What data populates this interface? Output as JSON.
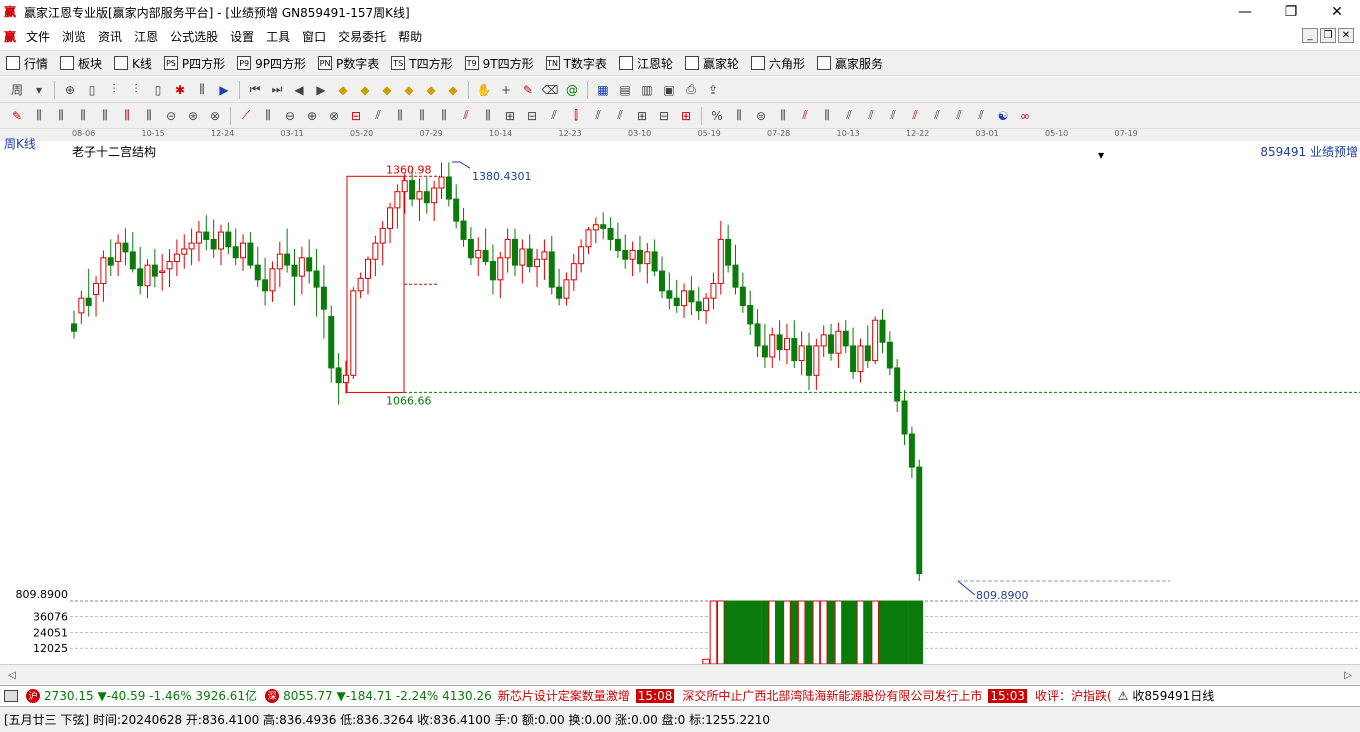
{
  "window": {
    "title": "赢家江恩专业版[赢家内部服务平台] - [业绩预增  GN859491-157周K线]",
    "logo_char": "赢",
    "min": "—",
    "max": "❐",
    "close": "✕"
  },
  "menu": {
    "items": [
      "文件",
      "浏览",
      "资讯",
      "江恩",
      "公式选股",
      "设置",
      "工具",
      "窗口",
      "交易委托",
      "帮助"
    ]
  },
  "toolbar1": {
    "items": [
      {
        "icon": "grid-icon",
        "label": "行情"
      },
      {
        "icon": "blocks-icon",
        "label": "板块"
      },
      {
        "icon": "kline-icon",
        "label": "K线"
      },
      {
        "icon": "ps-icon",
        "label": "P四方形",
        "code": "PS"
      },
      {
        "icon": "p9-icon",
        "label": "9P四方形",
        "code": "P9"
      },
      {
        "icon": "pn-icon",
        "label": "P数字表",
        "code": "PN"
      },
      {
        "icon": "ts-icon",
        "label": "T四方形",
        "code": "TS"
      },
      {
        "icon": "t9-icon",
        "label": "9T四方形",
        "code": "T9"
      },
      {
        "icon": "tn-icon",
        "label": "T数字表",
        "code": "TN"
      },
      {
        "icon": "wheel-icon",
        "label": "江恩轮"
      },
      {
        "icon": "wheel2-icon",
        "label": "赢家轮"
      },
      {
        "icon": "hexagon-icon",
        "label": "六角形"
      },
      {
        "icon": "dollar-icon",
        "label": "赢家服务"
      }
    ]
  },
  "chart": {
    "period_label": "周K线",
    "study_name": "老子十二宫结构",
    "code_label": "859491  业绩预增",
    "date_ticks": [
      "08-06",
      "10-15",
      "12-24",
      "03-11",
      "05-20",
      "07-29",
      "10-14",
      "12-23",
      "03-10",
      "05-19",
      "07-28",
      "10-13",
      "12-22",
      "03-01",
      "05-10",
      "07-19"
    ],
    "annotations": {
      "box_top": "1360.98",
      "box_bottom": "1066.66",
      "high_label": "1380.4301",
      "low_label": "809.8900"
    },
    "volume_axis": {
      "price_left": "809.8900",
      "ticks": [
        "36076",
        "24051",
        "12025"
      ]
    },
    "colors": {
      "up": "#e00000",
      "down": "#0a7a0a",
      "dash": "#0a7a0a",
      "box": "#e00000",
      "label_blue": "#1a3fa8"
    }
  },
  "chart_data": {
    "type": "candlestick",
    "title": "老子十二宫结构",
    "series": [
      {
        "name": "859491 业绩预增",
        "ohlc": [
          [
            1160,
            1178,
            1140,
            1150
          ],
          [
            1175,
            1205,
            1160,
            1195
          ],
          [
            1195,
            1235,
            1170,
            1185
          ],
          [
            1200,
            1225,
            1170,
            1215
          ],
          [
            1215,
            1260,
            1190,
            1250
          ],
          [
            1250,
            1275,
            1225,
            1240
          ],
          [
            1245,
            1282,
            1225,
            1270
          ],
          [
            1270,
            1290,
            1240,
            1258
          ],
          [
            1258,
            1285,
            1230,
            1235
          ],
          [
            1235,
            1265,
            1200,
            1212
          ],
          [
            1212,
            1248,
            1195,
            1240
          ],
          [
            1240,
            1262,
            1210,
            1225
          ],
          [
            1230,
            1255,
            1205,
            1232
          ],
          [
            1235,
            1262,
            1210,
            1245
          ],
          [
            1245,
            1275,
            1225,
            1255
          ],
          [
            1255,
            1282,
            1235,
            1262
          ],
          [
            1262,
            1290,
            1240,
            1270
          ],
          [
            1270,
            1300,
            1245,
            1285
          ],
          [
            1285,
            1308,
            1260,
            1275
          ],
          [
            1275,
            1302,
            1250,
            1262
          ],
          [
            1262,
            1295,
            1240,
            1285
          ],
          [
            1285,
            1298,
            1255,
            1265
          ],
          [
            1265,
            1290,
            1240,
            1250
          ],
          [
            1250,
            1282,
            1232,
            1270
          ],
          [
            1270,
            1285,
            1235,
            1240
          ],
          [
            1240,
            1265,
            1210,
            1220
          ],
          [
            1220,
            1250,
            1185,
            1205
          ],
          [
            1205,
            1245,
            1190,
            1235
          ],
          [
            1235,
            1272,
            1210,
            1255
          ],
          [
            1255,
            1290,
            1230,
            1240
          ],
          [
            1240,
            1262,
            1185,
            1225
          ],
          [
            1225,
            1265,
            1200,
            1250
          ],
          [
            1250,
            1275,
            1215,
            1232
          ],
          [
            1232,
            1262,
            1170,
            1210
          ],
          [
            1210,
            1240,
            1140,
            1180
          ],
          [
            1170,
            1185,
            1080,
            1100
          ],
          [
            1100,
            1120,
            1050,
            1080
          ],
          [
            1080,
            1110,
            1065,
            1090
          ],
          [
            1090,
            1210,
            1085,
            1205
          ],
          [
            1205,
            1230,
            1195,
            1222
          ],
          [
            1222,
            1252,
            1200,
            1248
          ],
          [
            1248,
            1280,
            1225,
            1270
          ],
          [
            1270,
            1300,
            1240,
            1290
          ],
          [
            1290,
            1325,
            1270,
            1318
          ],
          [
            1318,
            1350,
            1290,
            1340
          ],
          [
            1340,
            1365,
            1310,
            1355
          ],
          [
            1355,
            1370,
            1320,
            1330
          ],
          [
            1330,
            1358,
            1300,
            1340
          ],
          [
            1340,
            1360,
            1310,
            1325
          ],
          [
            1325,
            1355,
            1300,
            1345
          ],
          [
            1345,
            1380,
            1330,
            1360
          ],
          [
            1360,
            1380,
            1320,
            1330
          ],
          [
            1330,
            1350,
            1290,
            1300
          ],
          [
            1300,
            1318,
            1265,
            1275
          ],
          [
            1275,
            1292,
            1240,
            1250
          ],
          [
            1250,
            1278,
            1225,
            1260
          ],
          [
            1260,
            1290,
            1240,
            1245
          ],
          [
            1245,
            1268,
            1200,
            1220
          ],
          [
            1220,
            1258,
            1195,
            1250
          ],
          [
            1250,
            1290,
            1230,
            1275
          ],
          [
            1275,
            1290,
            1225,
            1240
          ],
          [
            1240,
            1275,
            1215,
            1262
          ],
          [
            1262,
            1282,
            1230,
            1238
          ],
          [
            1238,
            1262,
            1210,
            1248
          ],
          [
            1248,
            1275,
            1220,
            1258
          ],
          [
            1258,
            1280,
            1200,
            1210
          ],
          [
            1210,
            1235,
            1185,
            1195
          ],
          [
            1195,
            1230,
            1185,
            1220
          ],
          [
            1220,
            1255,
            1205,
            1242
          ],
          [
            1242,
            1275,
            1230,
            1265
          ],
          [
            1265,
            1292,
            1255,
            1288
          ],
          [
            1288,
            1305,
            1270,
            1295
          ],
          [
            1295,
            1312,
            1275,
            1290
          ],
          [
            1290,
            1305,
            1260,
            1275
          ],
          [
            1275,
            1298,
            1250,
            1260
          ],
          [
            1260,
            1282,
            1235,
            1248
          ],
          [
            1248,
            1272,
            1225,
            1260
          ],
          [
            1260,
            1280,
            1230,
            1242
          ],
          [
            1242,
            1270,
            1215,
            1258
          ],
          [
            1258,
            1275,
            1225,
            1232
          ],
          [
            1232,
            1252,
            1195,
            1205
          ],
          [
            1205,
            1230,
            1180,
            1195
          ],
          [
            1195,
            1220,
            1175,
            1185
          ],
          [
            1185,
            1215,
            1168,
            1205
          ],
          [
            1205,
            1225,
            1172,
            1190
          ],
          [
            1190,
            1210,
            1165,
            1178
          ],
          [
            1178,
            1202,
            1160,
            1195
          ],
          [
            1195,
            1230,
            1180,
            1215
          ],
          [
            1215,
            1300,
            1200,
            1275
          ],
          [
            1275,
            1295,
            1230,
            1240
          ],
          [
            1240,
            1268,
            1200,
            1210
          ],
          [
            1210,
            1230,
            1175,
            1185
          ],
          [
            1185,
            1205,
            1145,
            1160
          ],
          [
            1160,
            1180,
            1115,
            1130
          ],
          [
            1130,
            1160,
            1100,
            1115
          ],
          [
            1115,
            1155,
            1100,
            1145
          ],
          [
            1145,
            1165,
            1110,
            1125
          ],
          [
            1125,
            1160,
            1105,
            1140
          ],
          [
            1140,
            1165,
            1100,
            1110
          ],
          [
            1110,
            1150,
            1090,
            1130
          ],
          [
            1130,
            1148,
            1070,
            1090
          ],
          [
            1090,
            1140,
            1070,
            1130
          ],
          [
            1130,
            1158,
            1115,
            1145
          ],
          [
            1145,
            1160,
            1110,
            1120
          ],
          [
            1120,
            1162,
            1100,
            1150
          ],
          [
            1150,
            1165,
            1120,
            1130
          ],
          [
            1130,
            1155,
            1085,
            1095
          ],
          [
            1095,
            1140,
            1080,
            1130
          ],
          [
            1130,
            1158,
            1100,
            1110
          ],
          [
            1110,
            1170,
            1105,
            1165
          ],
          [
            1165,
            1180,
            1120,
            1135
          ],
          [
            1135,
            1150,
            1090,
            1100
          ],
          [
            1100,
            1112,
            1040,
            1055
          ],
          [
            1055,
            1070,
            995,
            1010
          ],
          [
            1010,
            1020,
            950,
            965
          ],
          [
            965,
            975,
            810,
            820
          ]
        ]
      }
    ],
    "x": [
      "08-06",
      "10-15",
      "12-24",
      "03-11",
      "05-20",
      "07-29",
      "10-14",
      "12-23",
      "03-10",
      "05-19",
      "07-28",
      "10-13",
      "12-22",
      "03-01",
      "05-10",
      "07-19"
    ],
    "ylim": [
      809.89,
      1380.4301
    ],
    "reference_lines": [
      1360.98,
      1066.66,
      809.89
    ],
    "volume": [
      0,
      0,
      0,
      0,
      0,
      0,
      0,
      0,
      0,
      0,
      0,
      0,
      0,
      0,
      0,
      0,
      0,
      0,
      0,
      0,
      0,
      0,
      0,
      0,
      0,
      0,
      0,
      0,
      0,
      0,
      0,
      0,
      0,
      0,
      0,
      0,
      0,
      0,
      0,
      0,
      0,
      0,
      0,
      0,
      0,
      0,
      0,
      0,
      0,
      0,
      0,
      0,
      0,
      0,
      0,
      0,
      0,
      0,
      0,
      0,
      0,
      0,
      0,
      0,
      0,
      0,
      0,
      0,
      0,
      0,
      0,
      0,
      0,
      0,
      0,
      0,
      0,
      0,
      0,
      0,
      0,
      0,
      0,
      0,
      0,
      0,
      3600,
      48000,
      48000,
      48000,
      48000,
      48000,
      48000,
      48000,
      48000,
      48000,
      48000,
      48000,
      48000,
      48000,
      48000,
      48000,
      48000,
      48000,
      48000,
      48000,
      48000,
      48000,
      48000,
      48000,
      48000,
      48000,
      48000,
      48000,
      48000,
      48000
    ],
    "volume_ticks": [
      36076,
      24051,
      12025
    ]
  },
  "ticker": {
    "idx1_badge": "沪",
    "idx1": "2730.15 ▼-40.59 -1.46% 3926.61亿",
    "idx2_badge": "深",
    "idx2": "8055.77 ▼-184.71 -2.24% 4130.26",
    "news1": "新芯片设计定案数量激增",
    "time1": "15:08",
    "news2": "深交所中止广西北部湾陆海新能源股份有限公司发行上市",
    "time2": "15:03",
    "news3": "收评：沪指跌(",
    "right_label": "收859491日线"
  },
  "status": {
    "text": "[五月廿三  下弦] 时间:20240628 开:836.4100 高:836.4936 低:836.3264 收:836.4100 手:0 额:0.00 换:0.00 涨:0.00 盘:0 标:1255.2210"
  }
}
